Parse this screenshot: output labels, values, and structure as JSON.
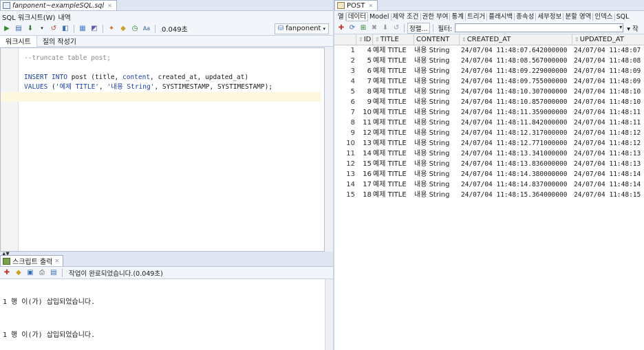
{
  "left": {
    "file_tab": "fanponent~exampleSQL.sql",
    "menu": [
      "SQL 워크시트(W)",
      "내역"
    ],
    "timing": "0.049초",
    "connection": "fanponent",
    "subtabs": [
      "워크시트",
      "질의 작성기"
    ],
    "code": {
      "line1": "--truncate table post;",
      "line2_kw1": "INSERT INTO",
      "line2_mid": " post (title, ",
      "line2_kw2": "content",
      "line2_end": ", created_at, updated_at)",
      "line3_kw": "VALUES",
      "line3_a": " (",
      "line3_s1": "'예제 TITLE'",
      "line3_b": ", ",
      "line3_s2": "'내용 String'",
      "line3_c": ", SYSTIMESTAMP, SYSTIMESTAMP);"
    },
    "output": {
      "tab": "스크립트 출력",
      "message": "작업이 완료되었습니다.(0.049초)",
      "lines": [
        "1 행 이(가) 삽입되었습니다.",
        "1 행 이(가) 삽입되었습니다."
      ]
    }
  },
  "right": {
    "tab": "POST",
    "menu": [
      "열",
      "데이터",
      "Model",
      "제약 조건",
      "권한 부여",
      "통계",
      "트리거",
      "플래시백",
      "종속성",
      "세부정보",
      "분할 영역",
      "인덱스",
      "SQL"
    ],
    "sort_label": "정렬...",
    "filter_label": "필터:",
    "trunc_label": "▾ 작",
    "columns": [
      "ID",
      "TITLE",
      "CONTENT",
      "CREATED_AT",
      "UPDATED_AT"
    ],
    "rows": [
      {
        "rn": "1",
        "id": "4",
        "title": "예제 TITLE",
        "content": "내용 String",
        "created": "24/07/04 11:48:07.642000000",
        "updated": "24/07/04 11:48:07"
      },
      {
        "rn": "2",
        "id": "5",
        "title": "예제 TITLE",
        "content": "내용 String",
        "created": "24/07/04 11:48:08.567000000",
        "updated": "24/07/04 11:48:08"
      },
      {
        "rn": "3",
        "id": "6",
        "title": "예제 TITLE",
        "content": "내용 String",
        "created": "24/07/04 11:48:09.229000000",
        "updated": "24/07/04 11:48:09"
      },
      {
        "rn": "4",
        "id": "7",
        "title": "예제 TITLE",
        "content": "내용 String",
        "created": "24/07/04 11:48:09.755000000",
        "updated": "24/07/04 11:48:09"
      },
      {
        "rn": "5",
        "id": "8",
        "title": "예제 TITLE",
        "content": "내용 String",
        "created": "24/07/04 11:48:10.307000000",
        "updated": "24/07/04 11:48:10"
      },
      {
        "rn": "6",
        "id": "9",
        "title": "예제 TITLE",
        "content": "내용 String",
        "created": "24/07/04 11:48:10.857000000",
        "updated": "24/07/04 11:48:10"
      },
      {
        "rn": "7",
        "id": "10",
        "title": "예제 TITLE",
        "content": "내용 String",
        "created": "24/07/04 11:48:11.359000000",
        "updated": "24/07/04 11:48:11"
      },
      {
        "rn": "8",
        "id": "11",
        "title": "예제 TITLE",
        "content": "내용 String",
        "created": "24/07/04 11:48:11.842000000",
        "updated": "24/07/04 11:48:11"
      },
      {
        "rn": "9",
        "id": "12",
        "title": "예제 TITLE",
        "content": "내용 String",
        "created": "24/07/04 11:48:12.317000000",
        "updated": "24/07/04 11:48:12"
      },
      {
        "rn": "10",
        "id": "13",
        "title": "예제 TITLE",
        "content": "내용 String",
        "created": "24/07/04 11:48:12.771000000",
        "updated": "24/07/04 11:48:12"
      },
      {
        "rn": "11",
        "id": "14",
        "title": "예제 TITLE",
        "content": "내용 String",
        "created": "24/07/04 11:48:13.341000000",
        "updated": "24/07/04 11:48:13"
      },
      {
        "rn": "12",
        "id": "15",
        "title": "예제 TITLE",
        "content": "내용 String",
        "created": "24/07/04 11:48:13.836000000",
        "updated": "24/07/04 11:48:13"
      },
      {
        "rn": "13",
        "id": "16",
        "title": "예제 TITLE",
        "content": "내용 String",
        "created": "24/07/04 11:48:14.380000000",
        "updated": "24/07/04 11:48:14"
      },
      {
        "rn": "14",
        "id": "17",
        "title": "예제 TITLE",
        "content": "내용 String",
        "created": "24/07/04 11:48:14.837000000",
        "updated": "24/07/04 11:48:14"
      },
      {
        "rn": "15",
        "id": "18",
        "title": "예제 TITLE",
        "content": "내용 String",
        "created": "24/07/04 11:48:15.364000000",
        "updated": "24/07/04 11:48:15"
      }
    ]
  },
  "icons": {
    "run": "play-icon",
    "run_script": "run-script-icon",
    "commit": "commit-icon",
    "rollback": "rollback-icon",
    "pin": "pin-icon",
    "refresh": "refresh-icon"
  }
}
